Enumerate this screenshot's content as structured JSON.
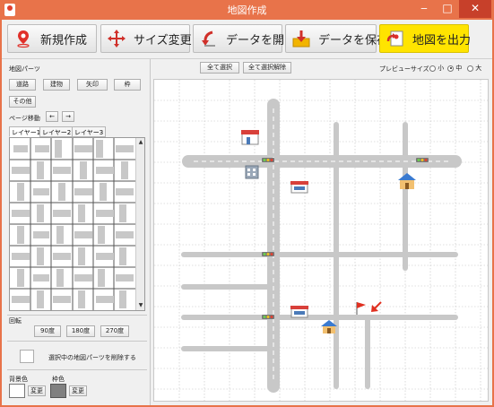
{
  "window": {
    "title": "地図作成",
    "min": "‒",
    "max": "□",
    "close": "✕"
  },
  "toolbar": {
    "new": "新規作成",
    "resize": "サイズ変更",
    "open": "データを開く",
    "save": "データを保存",
    "export": "地図を出力",
    "accent_color": "#ffe400"
  },
  "parts": {
    "label": "地図パーツ",
    "road": "道路",
    "building": "建物",
    "arrow": "矢印",
    "frame": "枠",
    "other": "その他"
  },
  "page_move": {
    "label": "ページ移動",
    "prev": "←",
    "next": "→"
  },
  "layers": {
    "tabs": [
      "レイヤー1",
      "レイヤー2",
      "レイヤー3"
    ],
    "active": 0
  },
  "rotate": {
    "label": "回転",
    "r90": "90度",
    "r180": "180度",
    "r270": "270度"
  },
  "delete_label": "選択中の地図パーツを削除する",
  "colors": {
    "bg_label": "背景色",
    "frame_label": "枠色",
    "change": "変更",
    "bg_value": "#ffffff",
    "frame_value": "#808080"
  },
  "main": {
    "select_all": "全て選択",
    "deselect_all": "全て選択解除",
    "preview_label": "プレビューサイズ",
    "size_small": "小",
    "size_medium": "中",
    "size_large": "大",
    "size_selected": "中"
  },
  "map": {
    "road_color": "#c8c8c8",
    "icons": [
      "shop-icon",
      "house-icon",
      "building-icon",
      "flag-icon",
      "arrow-icon",
      "traffic-light-icon"
    ]
  }
}
